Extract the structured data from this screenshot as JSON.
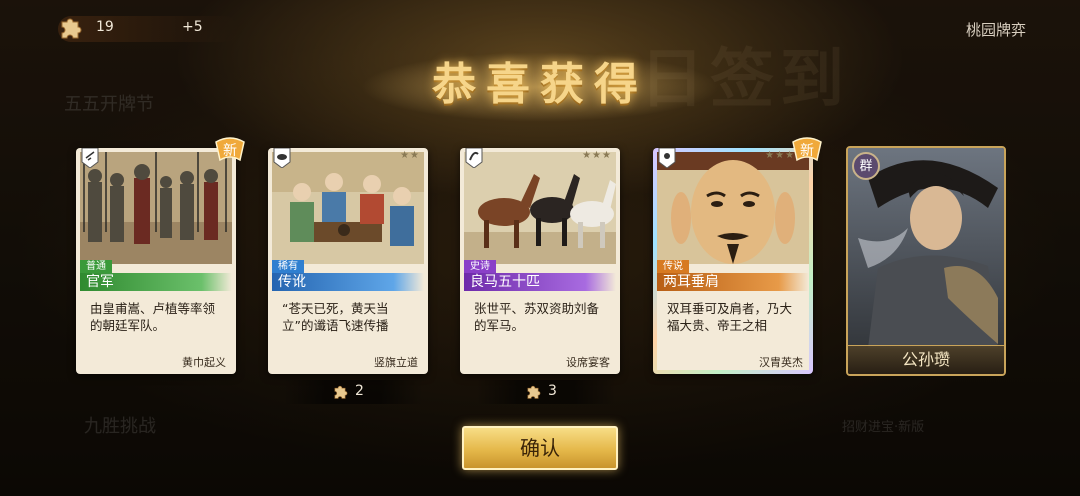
{
  "top_bar": {
    "puzzle_count": "19",
    "puzzle_plus": "+5",
    "game_title": "桃园牌弈"
  },
  "background": {
    "menu_item_1": "五五开牌节",
    "menu_item_2": "九胜挑战",
    "menu_item_3": "招财进宝·新版",
    "sign_text": "日签到"
  },
  "title": "恭喜获得",
  "cards": [
    {
      "rarity": "普通",
      "name": "官军",
      "desc": "由皇甫嵩、卢植等率领的朝廷军队。",
      "source": "黄巾起义",
      "stars": "★",
      "is_new": true,
      "new_label": "新"
    },
    {
      "rarity": "稀有",
      "name": "传讹",
      "desc": "“苍天已死，黄天当立”的谶语飞速传播",
      "source": "竖旗立道",
      "stars": "★★",
      "is_new": false
    },
    {
      "rarity": "史诗",
      "name": "良马五十匹",
      "desc": "张世平、苏双资助刘备的军马。",
      "source": "设席宴客",
      "stars": "★★★",
      "is_new": false
    },
    {
      "rarity": "传说",
      "name": "两耳垂肩",
      "desc": "双耳垂可及肩者，乃大福大贵、帝王之相",
      "source": "汉胄英杰",
      "stars": "★★★★",
      "is_new": true,
      "new_label": "新"
    }
  ],
  "hero": {
    "faction": "群",
    "name": "公孙瓒"
  },
  "fragments": [
    {
      "count": "2"
    },
    {
      "count": "3"
    }
  ],
  "confirm_label": "确认",
  "colors": {
    "accent_gold": "#e5b84a",
    "common": "#3a9a3a",
    "rare": "#2f7fd0",
    "epic": "#8a3fc8",
    "legend": "#d77a22"
  }
}
